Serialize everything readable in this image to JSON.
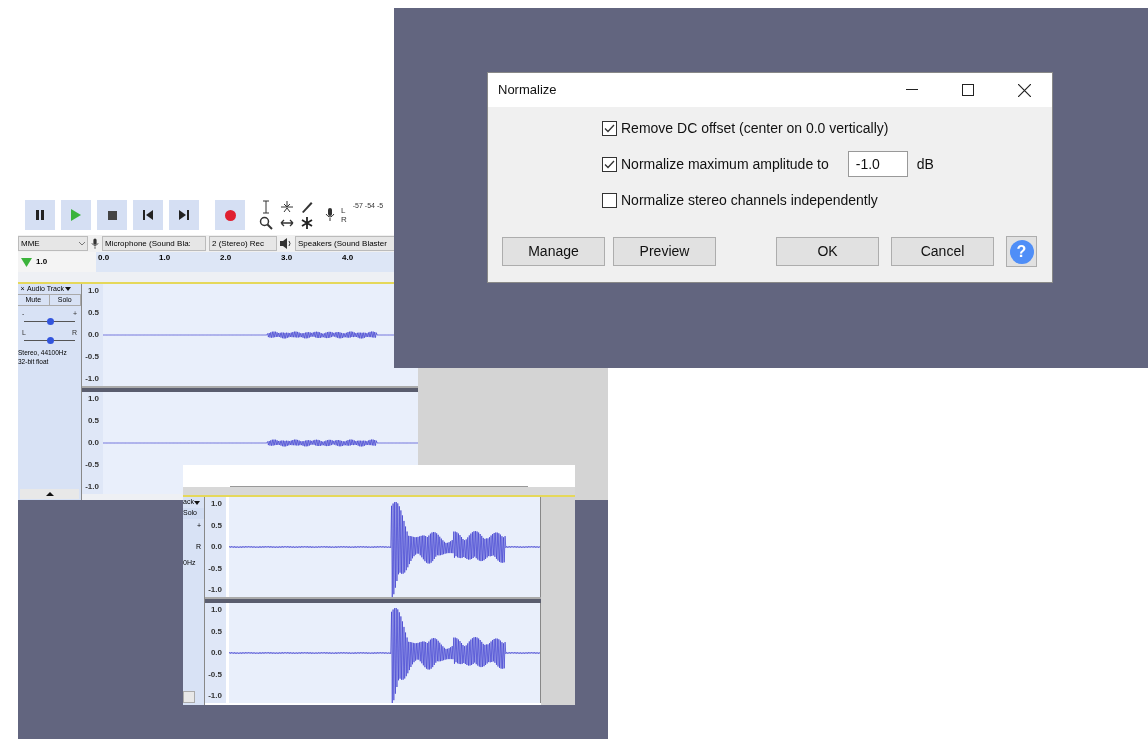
{
  "main_window": {
    "meter": {
      "channels": [
        "L",
        "R"
      ],
      "scale": "-57 -54 -5"
    },
    "devices": {
      "host": "MME",
      "recording_device": "Microphone (Sound Bla:",
      "channels": "2 (Stereo) Rec",
      "playback_device": "Speakers (Sound Blaster"
    },
    "ruler": {
      "level_label": "1.0",
      "ticks": [
        "0.0",
        "1.0",
        "2.0",
        "3.0",
        "4.0"
      ]
    },
    "track": {
      "close": "×",
      "name": "Audio Track",
      "buttons": [
        "Mute",
        "Solo"
      ],
      "gain": {
        "labels": [
          "-",
          "+"
        ],
        "level": 0.5
      },
      "pan": {
        "labels": [
          "L",
          "R"
        ],
        "level": 0.5
      },
      "info": [
        "Stereo, 44100Hz",
        "32-bit float"
      ],
      "channels": [
        {
          "scale": [
            "1.0",
            "0.5",
            "0.0",
            "-0.5",
            "-1.0"
          ]
        },
        {
          "scale": [
            "1.0",
            "0.5",
            "0.0",
            "-0.5",
            "-1.0"
          ]
        }
      ]
    }
  },
  "zoomed_window": {
    "track": {
      "name": "ack",
      "buttons": [
        "Solo"
      ],
      "gain_label": "+",
      "pan_label": "R",
      "info": "0Hz"
    },
    "channels": [
      {
        "scale": [
          "1.0",
          "0.5",
          "0.0",
          "-0.5",
          "-1.0"
        ]
      },
      {
        "scale": [
          "1.0",
          "0.5",
          "0.0",
          "-0.5",
          "-1.0"
        ]
      }
    ]
  },
  "dialog": {
    "title": "Normalize",
    "options": [
      {
        "label": "Remove DC offset (center on 0.0 vertically)",
        "checked": true
      },
      {
        "label": "Normalize maximum amplitude to",
        "checked": true,
        "value": "-1.0",
        "unit": "dB"
      },
      {
        "label": "Normalize stereo channels independently",
        "checked": false
      }
    ],
    "buttons": [
      "Manage",
      "Preview",
      "OK",
      "Cancel"
    ],
    "help": "?"
  }
}
